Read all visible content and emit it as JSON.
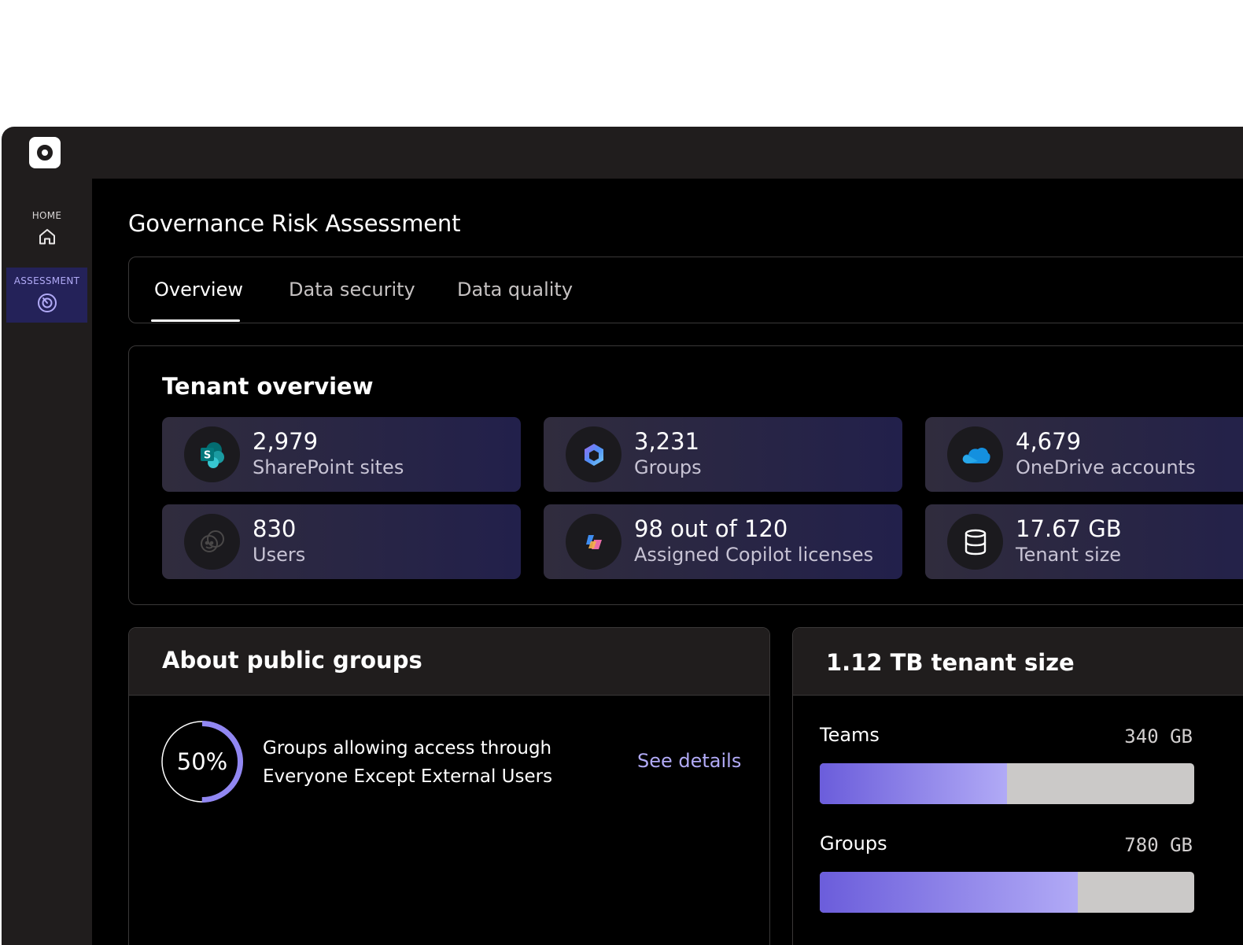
{
  "sidebar": {
    "items": [
      {
        "label": "HOME",
        "icon": "home-icon"
      },
      {
        "label": "ASSESSMENT",
        "icon": "assessment-icon"
      }
    ]
  },
  "page": {
    "title": "Governance Risk Assessment"
  },
  "tabs": [
    {
      "label": "Overview",
      "active": true
    },
    {
      "label": "Data security",
      "active": false
    },
    {
      "label": "Data quality",
      "active": false
    }
  ],
  "tenant_overview": {
    "title": "Tenant overview",
    "stats": [
      {
        "value": "2,979",
        "label": "SharePoint sites",
        "icon": "sharepoint-icon"
      },
      {
        "value": "3,231",
        "label": "Groups",
        "icon": "groups-icon"
      },
      {
        "value": "4,679",
        "label": "OneDrive accounts",
        "icon": "onedrive-icon"
      },
      {
        "value": "830",
        "label": "Users",
        "icon": "users-icon"
      },
      {
        "value": "98 out of 120",
        "label": "Assigned Copilot licenses",
        "icon": "copilot-icon"
      },
      {
        "value": "17.67 GB",
        "label": "Tenant size",
        "icon": "database-icon"
      }
    ]
  },
  "public_groups": {
    "title": "About public groups",
    "percent_label": "50%",
    "percent": 0.5,
    "desc_line1": "Groups allowing access through",
    "desc_line2": "Everyone Except External Users",
    "link": "See details"
  },
  "tenant_size": {
    "title": "1.12 TB tenant size",
    "bars": [
      {
        "label": "Teams",
        "value": "340 GB",
        "fraction": 0.5
      },
      {
        "label": "Groups",
        "value": "780 GB",
        "fraction": 0.69
      }
    ]
  },
  "colors": {
    "accent": "#b1aaf6",
    "accent_dark": "#6b5ddb",
    "sidebar_active": "#242259"
  }
}
